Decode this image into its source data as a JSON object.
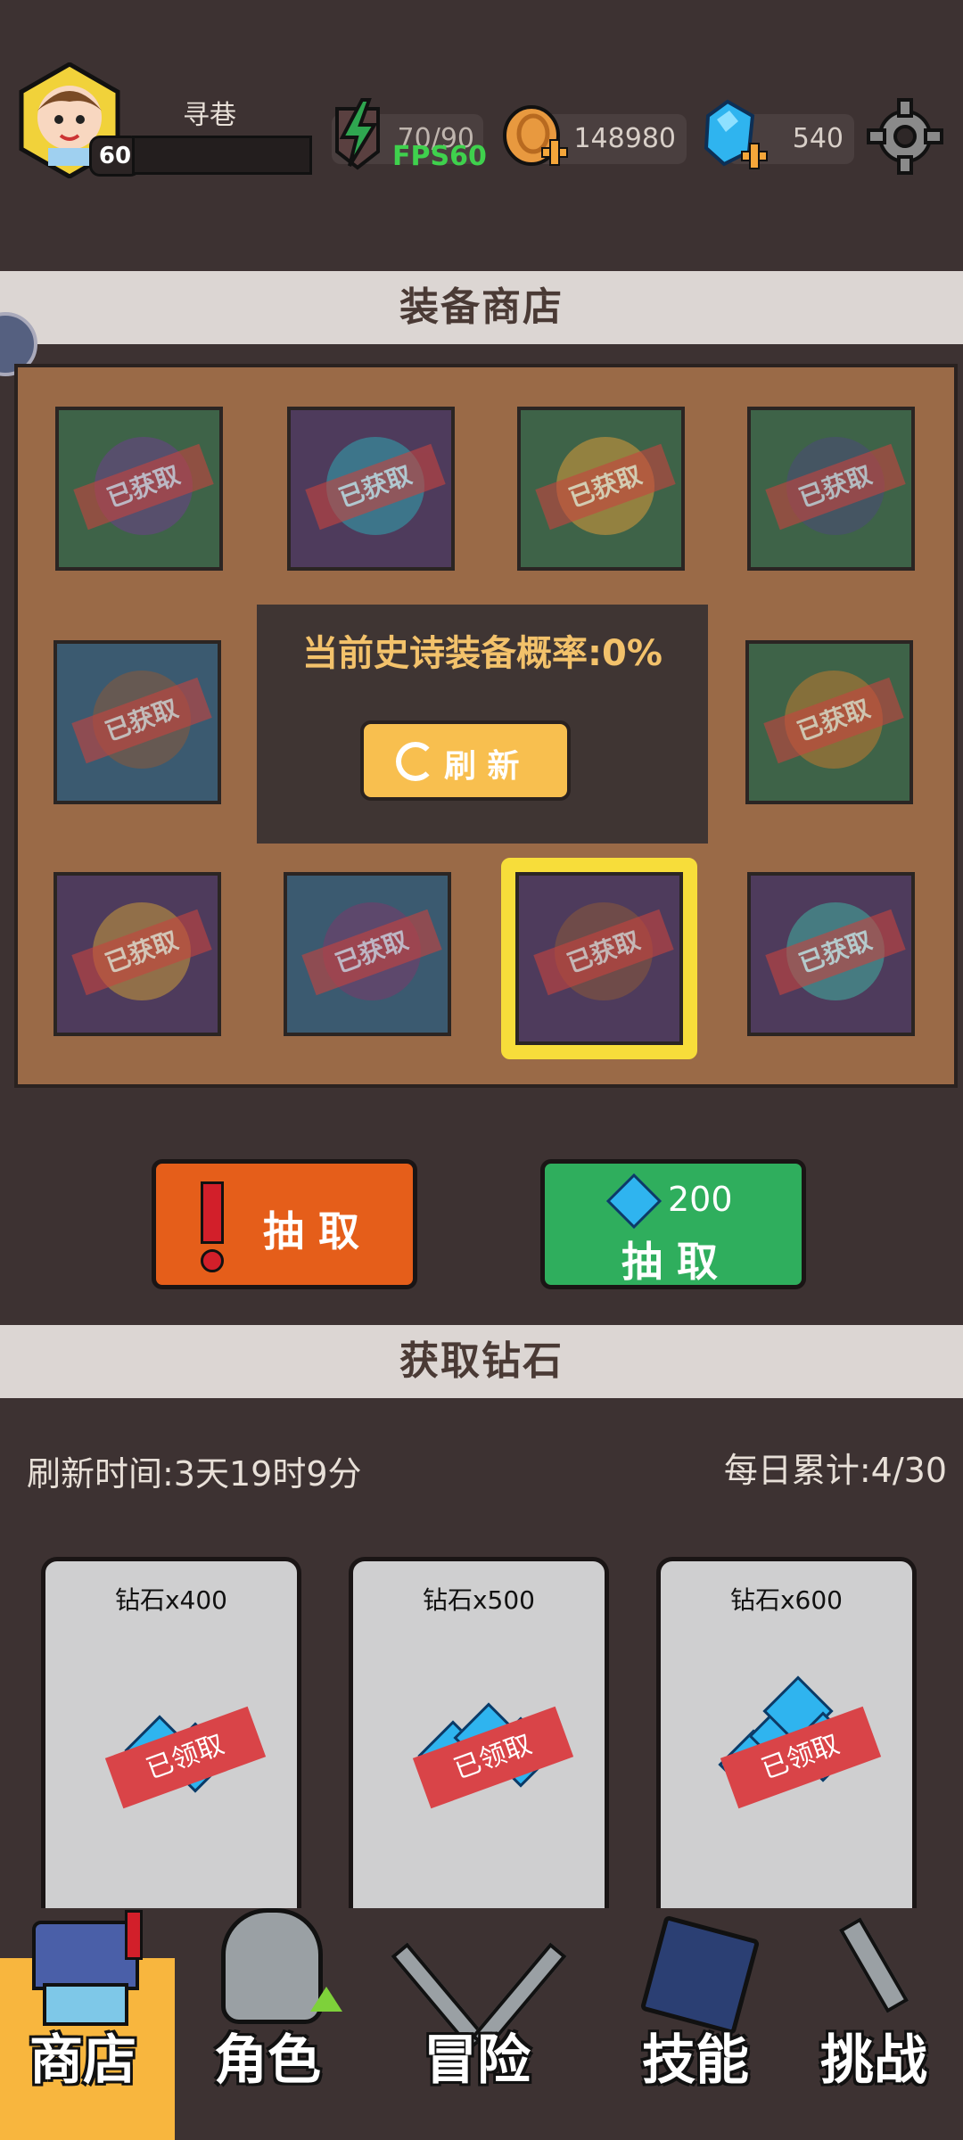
{
  "player": {
    "name": "寻巷",
    "level": "60"
  },
  "resources": {
    "energy": "70/90",
    "fps": "FPS60",
    "coins": "148980",
    "diamonds": "540"
  },
  "equipment_shop": {
    "title": "装备商店",
    "probability_text": "当前史诗装备概率:0%",
    "refresh_label": "刷 新",
    "obtained_stamp": "已获取",
    "draw_free_label": "抽 取",
    "draw_paid_cost": "200",
    "draw_paid_label": "抽 取"
  },
  "diamond_shop": {
    "title": "获取钻石",
    "refresh_time": "刷新时间:3天19时9分",
    "daily_total": "每日累计:4/30",
    "cards": [
      {
        "title": "钻石x400",
        "status": "已领取"
      },
      {
        "title": "钻石x500",
        "status": "已领取"
      },
      {
        "title": "钻石x600",
        "status": "已领取"
      }
    ]
  },
  "nav": {
    "shop": "商店",
    "character": "角色",
    "adventure": "冒险",
    "skills": "技能",
    "challenge": "挑战"
  }
}
